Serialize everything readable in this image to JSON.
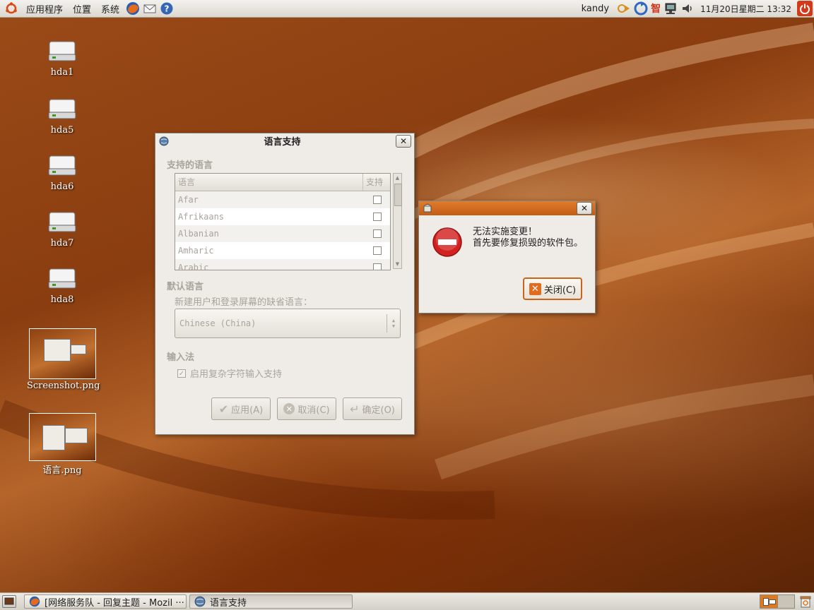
{
  "top_panel": {
    "menus": [
      "应用程序",
      "位置",
      "系统"
    ],
    "user": "kandy",
    "ime_label": "智",
    "clock": "11月20日星期二 13:32"
  },
  "desktop_icons": [
    {
      "label": "hda1",
      "icon": "drive-icon"
    },
    {
      "label": "hda5",
      "icon": "drive-icon"
    },
    {
      "label": "hda6",
      "icon": "drive-icon"
    },
    {
      "label": "hda7",
      "icon": "drive-icon"
    },
    {
      "label": "hda8",
      "icon": "drive-icon"
    },
    {
      "label": "Screenshot.png",
      "icon": "image-thumbnail"
    },
    {
      "label": "语言.png",
      "icon": "image-thumbnail"
    }
  ],
  "language_dialog": {
    "title": "语言支持",
    "supported_languages_label": "支持的语言",
    "columns": [
      "语言",
      "支持"
    ],
    "languages": [
      {
        "name": "Afar",
        "supported": false
      },
      {
        "name": "Afrikaans",
        "supported": false
      },
      {
        "name": "Albanian",
        "supported": false
      },
      {
        "name": "Amharic",
        "supported": false
      },
      {
        "name": "Arabic",
        "supported": false
      }
    ],
    "default_language_label": "默认语言",
    "default_language_hint": "新建用户和登录屏幕的缺省语言：",
    "default_language_value": "Chinese (China)",
    "input_method_label": "输入法",
    "complex_input_label": "启用复杂字符输入支持",
    "complex_input_checked": true,
    "buttons": {
      "apply": "应用(A)",
      "cancel": "取消(C)",
      "ok": "确定(O)"
    }
  },
  "error_dialog": {
    "line1": "无法实施变更！",
    "line2": "首先要修复损毁的软件包。",
    "close_label": "关闭(C)"
  },
  "taskbar": {
    "tasks": [
      {
        "label": "[网络服务队 - 回复主题 - Mozil ···",
        "active": false
      },
      {
        "label": "语言支持",
        "active": true
      }
    ]
  },
  "colors": {
    "accent": "#d8641c",
    "panel": "#e6e2da",
    "error_red": "#d32020"
  }
}
